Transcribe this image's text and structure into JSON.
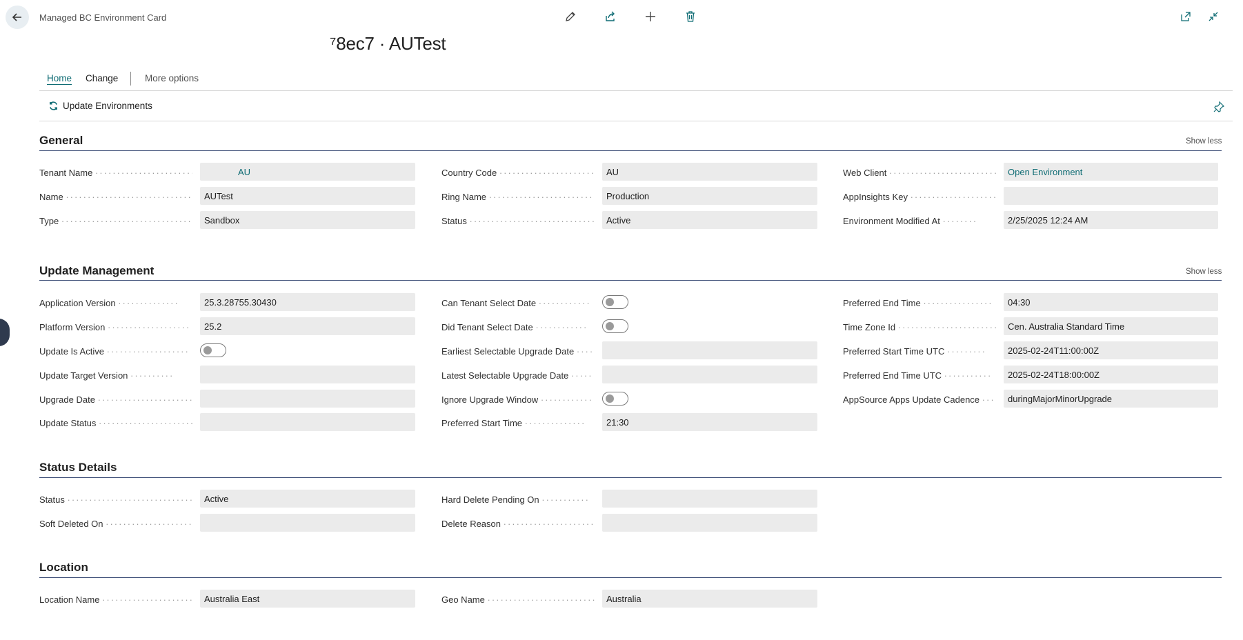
{
  "header": {
    "caption": "Managed BC Environment Card",
    "record_title": "⁷8ec7 · AUTest"
  },
  "icons": {
    "back": "back-arrow-icon",
    "edit": "pencil-icon",
    "share": "share-icon",
    "new": "plus-icon",
    "delete": "trash-icon",
    "open_new_window": "open-in-new-window-icon",
    "collapse": "collapse-icon",
    "refresh": "refresh-icon",
    "pin": "pin-icon"
  },
  "tabs": {
    "home": "Home",
    "change": "Change",
    "more": "More options"
  },
  "actions": {
    "update_environments": "Update Environments"
  },
  "colors": {
    "accent": "#0f6c74",
    "section_rule": "#41527a",
    "field_bg": "#ebebeb"
  },
  "sections": {
    "general": {
      "title": "General",
      "show_less": "Show less",
      "tenant_name_label": "Tenant Name",
      "tenant_name": "AU",
      "name_label": "Name",
      "name": "AUTest",
      "type_label": "Type",
      "type": "Sandbox",
      "country_code_label": "Country Code",
      "country_code": "AU",
      "ring_name_label": "Ring Name",
      "ring_name": "Production",
      "status_label": "Status",
      "status": "Active",
      "web_client_label": "Web Client",
      "web_client": "Open Environment",
      "appinsights_key_label": "AppInsights Key",
      "appinsights_key": "",
      "env_modified_label": "Environment Modified At",
      "env_modified": "2/25/2025 12:24 AM"
    },
    "update": {
      "title": "Update Management",
      "show_less": "Show less",
      "app_version_label": "Application Version",
      "app_version": "25.3.28755.30430",
      "platform_version_label": "Platform Version",
      "platform_version": "25.2",
      "update_active_label": "Update Is Active",
      "update_active": false,
      "target_version_label": "Update Target Version",
      "target_version": "",
      "upgrade_date_label": "Upgrade Date",
      "upgrade_date": "",
      "update_status_label": "Update Status",
      "update_status": "",
      "can_select_label": "Can Tenant Select Date",
      "can_select": false,
      "did_select_label": "Did Tenant Select Date",
      "did_select": false,
      "earliest_label": "Earliest Selectable Upgrade Date",
      "earliest": "",
      "latest_label": "Latest Selectable Upgrade Date",
      "latest": "",
      "ignore_window_label": "Ignore Upgrade Window",
      "ignore_window": false,
      "pref_start_label": "Preferred Start Time",
      "pref_start": "21:30",
      "pref_end_label": "Preferred End Time",
      "pref_end": "04:30",
      "tz_label": "Time Zone Id",
      "tz": "Cen. Australia Standard Time",
      "pref_start_utc_label": "Preferred Start Time UTC",
      "pref_start_utc": "2025-02-24T11:00:00Z",
      "pref_end_utc_label": "Preferred End Time UTC",
      "pref_end_utc": "2025-02-24T18:00:00Z",
      "cadence_label": "AppSource Apps Update Cadence",
      "cadence": "duringMajorMinorUpgrade"
    },
    "status": {
      "title": "Status Details",
      "status_label": "Status",
      "status": "Active",
      "soft_deleted_label": "Soft Deleted On",
      "soft_deleted": "",
      "hard_delete_label": "Hard Delete Pending On",
      "hard_delete": "",
      "delete_reason_label": "Delete Reason",
      "delete_reason": ""
    },
    "location": {
      "title": "Location",
      "location_name_label": "Location Name",
      "location_name": "Australia East",
      "geo_name_label": "Geo Name",
      "geo_name": "Australia"
    }
  }
}
